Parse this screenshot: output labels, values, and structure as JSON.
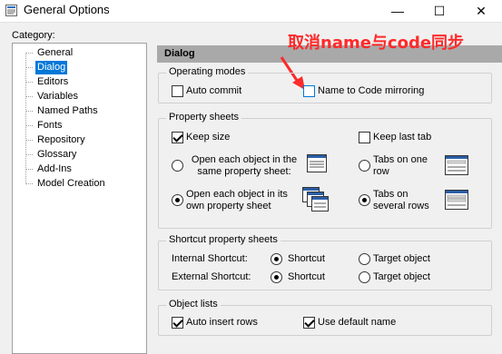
{
  "window": {
    "title": "General Options",
    "controls": {
      "minimize": "—",
      "maximize": "☐",
      "close": "✕"
    }
  },
  "category_label": "Category:",
  "tree": {
    "items": [
      {
        "label": "General",
        "selected": false
      },
      {
        "label": "Dialog",
        "selected": true
      },
      {
        "label": "Editors",
        "selected": false
      },
      {
        "label": "Variables",
        "selected": false
      },
      {
        "label": "Named Paths",
        "selected": false
      },
      {
        "label": "Fonts",
        "selected": false
      },
      {
        "label": "Repository",
        "selected": false
      },
      {
        "label": "Glossary",
        "selected": false
      },
      {
        "label": "Add-Ins",
        "selected": false
      },
      {
        "label": "Model Creation",
        "selected": false
      }
    ]
  },
  "panel": {
    "header": "Dialog"
  },
  "annotation": {
    "text": "取消name与code同步",
    "color": "#ff2a2a"
  },
  "operating_modes": {
    "title": "Operating modes",
    "auto_commit": {
      "label": "Auto commit",
      "checked": false
    },
    "name_to_code": {
      "label": "Name to Code mirroring",
      "checked": false
    }
  },
  "property_sheets": {
    "title": "Property sheets",
    "keep_size": {
      "label": "Keep size",
      "checked": true
    },
    "keep_last_tab": {
      "label": "Keep last tab",
      "checked": false
    },
    "open_same": {
      "label": "Open each object in the same property sheet:",
      "checked": false
    },
    "open_own": {
      "label": "Open each object in its own property sheet",
      "checked": true
    },
    "tabs_one_row": {
      "label": "Tabs on one row",
      "checked": false
    },
    "tabs_several_rows": {
      "label": "Tabs on several rows",
      "checked": true
    }
  },
  "shortcut_sheets": {
    "title": "Shortcut property sheets",
    "internal": {
      "label": "Internal Shortcut:",
      "shortcut": "Shortcut",
      "target": "Target object",
      "value": "shortcut"
    },
    "external": {
      "label": "External Shortcut:",
      "shortcut": "Shortcut",
      "target": "Target object",
      "value": "shortcut"
    }
  },
  "object_lists": {
    "title": "Object lists",
    "auto_insert_rows": {
      "label": "Auto insert rows",
      "checked": true
    },
    "use_default_name": {
      "label": "Use default name",
      "checked": true
    }
  },
  "colors": {
    "selection": "#0078d7",
    "header_bg": "#a9a9a9",
    "annotation": "#ff2a2a"
  }
}
